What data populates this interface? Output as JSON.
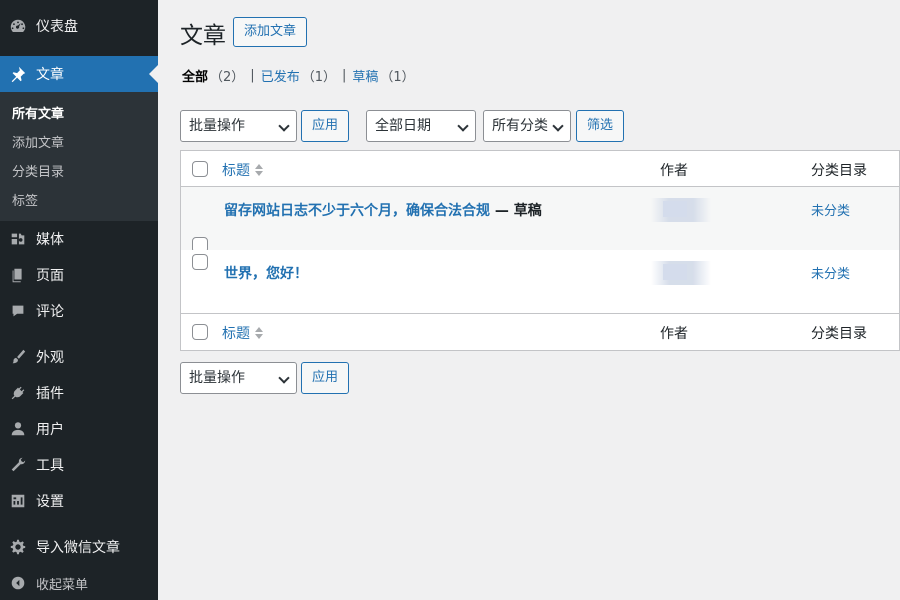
{
  "sidebar": {
    "items": [
      {
        "label": "仪表盘",
        "icon": "dashboard-icon"
      },
      {
        "label": "文章",
        "icon": "pushpin-icon",
        "current": true
      },
      {
        "label": "媒体",
        "icon": "media-icon"
      },
      {
        "label": "页面",
        "icon": "page-icon"
      },
      {
        "label": "评论",
        "icon": "comment-icon"
      },
      {
        "label": "外观",
        "icon": "brush-icon"
      },
      {
        "label": "插件",
        "icon": "plugin-icon"
      },
      {
        "label": "用户",
        "icon": "user-icon"
      },
      {
        "label": "工具",
        "icon": "wrench-icon"
      },
      {
        "label": "设置",
        "icon": "settings-icon"
      },
      {
        "label": "导入微信文章",
        "icon": "gear-icon"
      },
      {
        "label": "收起菜单",
        "icon": "collapse-icon"
      }
    ],
    "submenu": [
      "所有文章",
      "添加文章",
      "分类目录",
      "标签"
    ]
  },
  "main": {
    "title": "文章",
    "add_new": "添加文章",
    "filters": {
      "all_label": "全部",
      "all_count": "（2）",
      "published_label": "已发布",
      "published_count": "（1）",
      "draft_label": "草稿",
      "draft_count": "（1）",
      "separator": "|"
    },
    "bulk_action": "批量操作",
    "apply": "应用",
    "date_filter": "全部日期",
    "category_filter": "所有分类",
    "filter_button": "筛选",
    "table": {
      "col_title": "标题",
      "col_author": "作者",
      "col_categories": "分类目录",
      "rows": [
        {
          "title": "留存网站日志不少于六个月，确保合法合规",
          "state": " — 草稿",
          "category": "未分类"
        },
        {
          "title": "世界，您好！",
          "state": "",
          "category": "未分类"
        }
      ]
    }
  },
  "colors": {
    "sidebar_bg": "#1d2327",
    "submenu_bg": "#2c3338",
    "accent": "#2271b1",
    "page_bg": "#f0f0f1"
  }
}
